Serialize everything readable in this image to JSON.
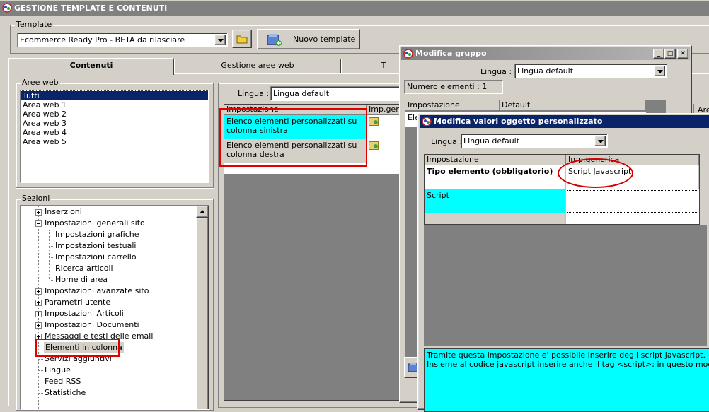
{
  "window": {
    "title": "GESTIONE TEMPLATE E CONTENUTI"
  },
  "template": {
    "group_label": "Template",
    "selected": "Ecommerce Ready Pro - BETA da rilasciare",
    "new_button": "Nuovo template"
  },
  "tabs": [
    {
      "label": "Contenuti"
    },
    {
      "label": "Gestione aree web"
    },
    {
      "label": "T"
    }
  ],
  "aree_web": {
    "label": "Aree web",
    "items": [
      "Tutti",
      "Area web 1",
      "Area web 2",
      "Area web 3",
      "Area web 4",
      "Area web 5"
    ]
  },
  "sezioni": {
    "label": "Sezioni",
    "items": [
      "Inserzioni",
      "Impostazioni generali sito",
      "Impostazioni grafiche",
      "Impostazioni testuali",
      "Impostazioni carrello",
      "Ricerca articoli",
      "Home di area",
      "Impostazioni avanzate sito",
      "Parametri utente",
      "Impostazioni Articoli",
      "Impostazioni Documenti",
      "Messaggi e testi delle email",
      "Elementi in colonna",
      "Servizi aggiuntivi",
      "Lingue",
      "Feed RSS",
      "Statistiche"
    ]
  },
  "main": {
    "lingua_label": "Lingua :",
    "lingua_value": "Lingua default",
    "grid_headers": [
      "Impostazione",
      "Imp.gene"
    ],
    "rows": [
      "Elenco elementi personalizzati su colonna sinistra",
      "Elenco elementi personalizzati su colonna destra"
    ],
    "right_header": "Are"
  },
  "gruppo": {
    "title": "Modifica gruppo",
    "lingua_label": "Lingua :",
    "lingua_value": "Lingua default",
    "count": "Numero elementi : 1",
    "headers": [
      "Impostazione",
      "Default"
    ],
    "row_partial": "Ele"
  },
  "valori": {
    "title": "Modifica valori oggetto personalizzato",
    "lingua_label": "Lingua :",
    "lingua_value": "Lingua default",
    "headers": [
      "Impostazione",
      "Imp.generica"
    ],
    "rows": [
      {
        "name": "Tipo elemento (obbligatorio)",
        "value": "Script Javascript"
      },
      {
        "name": "Script",
        "value": ""
      }
    ],
    "description": [
      "Tramite questa impostazione e' possibile inserire degli script javascript.",
      "Insieme al codice javascript inserire anche il tag <script>; in questo modo e' possibile"
    ]
  }
}
